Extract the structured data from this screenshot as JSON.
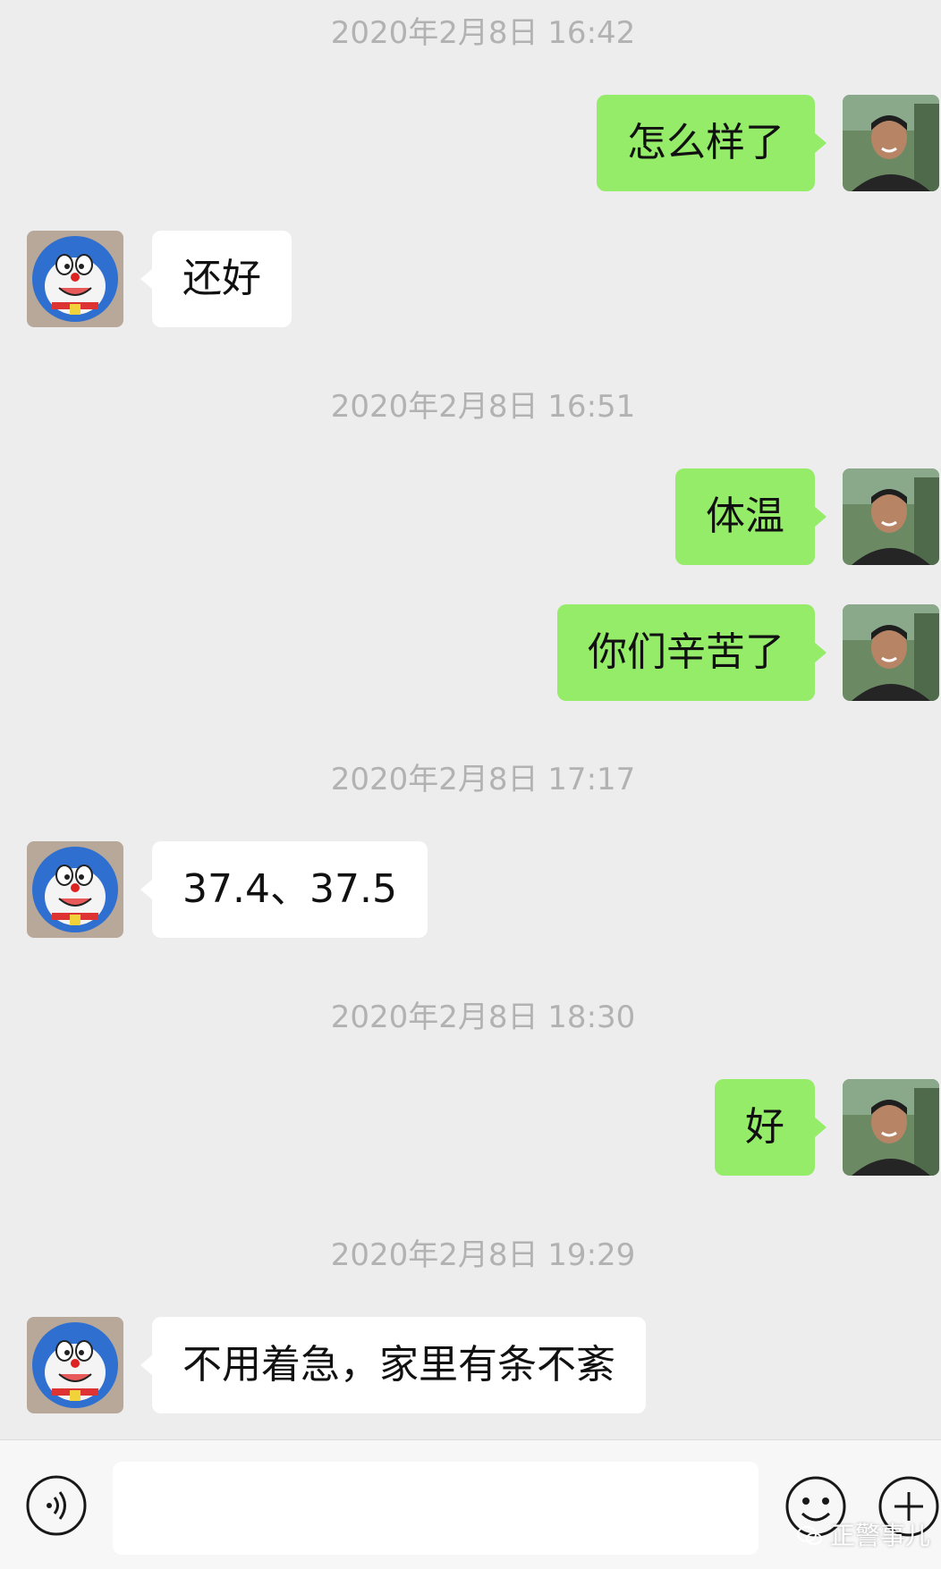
{
  "conversation": {
    "items": [
      {
        "kind": "timestamp",
        "text": "2020年2月8日 16:42"
      },
      {
        "kind": "message",
        "direction": "out",
        "text": "怎么样了"
      },
      {
        "kind": "message",
        "direction": "in",
        "text": "还好"
      },
      {
        "kind": "timestamp",
        "text": "2020年2月8日 16:51"
      },
      {
        "kind": "message",
        "direction": "out",
        "text": "体温"
      },
      {
        "kind": "message",
        "direction": "out",
        "text": "你们辛苦了"
      },
      {
        "kind": "timestamp",
        "text": "2020年2月8日 17:17"
      },
      {
        "kind": "message",
        "direction": "in",
        "text": "37.4、37.5"
      },
      {
        "kind": "timestamp",
        "text": "2020年2月8日 18:30"
      },
      {
        "kind": "message",
        "direction": "out",
        "text": "好"
      },
      {
        "kind": "timestamp",
        "text": "2020年2月8日 19:29"
      },
      {
        "kind": "message",
        "direction": "in",
        "text": "不用着急，家里有条不紊"
      }
    ]
  },
  "input_bar": {
    "input_value": "",
    "voice_icon": "voice-icon",
    "emoji_icon": "emoji-icon",
    "plus_icon": "plus-icon"
  },
  "watermark": {
    "text": "正警事儿",
    "icon": "wechat-icon"
  },
  "colors": {
    "background": "#ededed",
    "outgoing_bubble": "#95ec69",
    "incoming_bubble": "#ffffff",
    "timestamp_text": "#b2b2b2"
  }
}
